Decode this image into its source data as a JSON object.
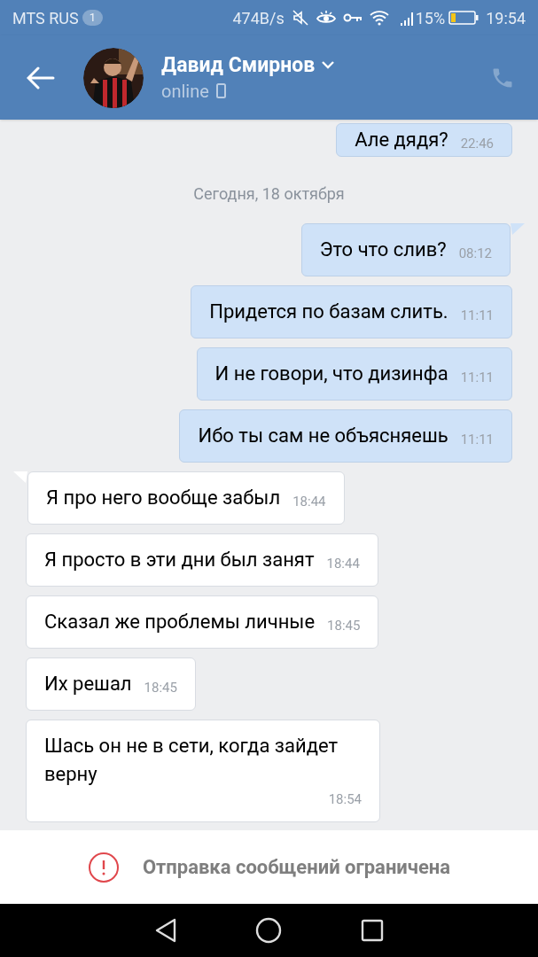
{
  "status_bar": {
    "carrier": "MTS RUS",
    "notification_count": "1",
    "net_speed": "474B/s",
    "battery_percent": "15%",
    "time": "19:54"
  },
  "header": {
    "name": "Давид Смирнов",
    "status": "online"
  },
  "messages": [
    {
      "kind": "outgoing",
      "text": "Але дядя?",
      "time": "22:46",
      "tail": false
    },
    {
      "kind": "date",
      "text": "Сегодня, 18 октября"
    },
    {
      "kind": "outgoing",
      "text": "Это что слив?",
      "time": "08:12",
      "tail": true
    },
    {
      "kind": "outgoing",
      "text": "Придется по базам слить.",
      "time": "11:11",
      "tail": false
    },
    {
      "kind": "outgoing",
      "text": "И не говори, что дизинфа",
      "time": "11:11",
      "tail": false
    },
    {
      "kind": "outgoing",
      "text": "Ибо ты сам не объясняешь",
      "time": "11:11",
      "tail": false
    },
    {
      "kind": "incoming",
      "text": "Я про него вообще забыл",
      "time": "18:44",
      "tail": true
    },
    {
      "kind": "incoming",
      "text": "Я просто в эти дни был занят",
      "time": "18:44",
      "tail": false
    },
    {
      "kind": "incoming",
      "text": "Сказал же проблемы личные",
      "time": "18:45",
      "tail": false
    },
    {
      "kind": "incoming",
      "text": "Их решал",
      "time": "18:45",
      "tail": false
    },
    {
      "kind": "incoming",
      "text": "Шась он не в сети, когда зайдет верну",
      "time": "18:54",
      "tail": false
    }
  ],
  "notice": "Отправка сообщений ограничена"
}
